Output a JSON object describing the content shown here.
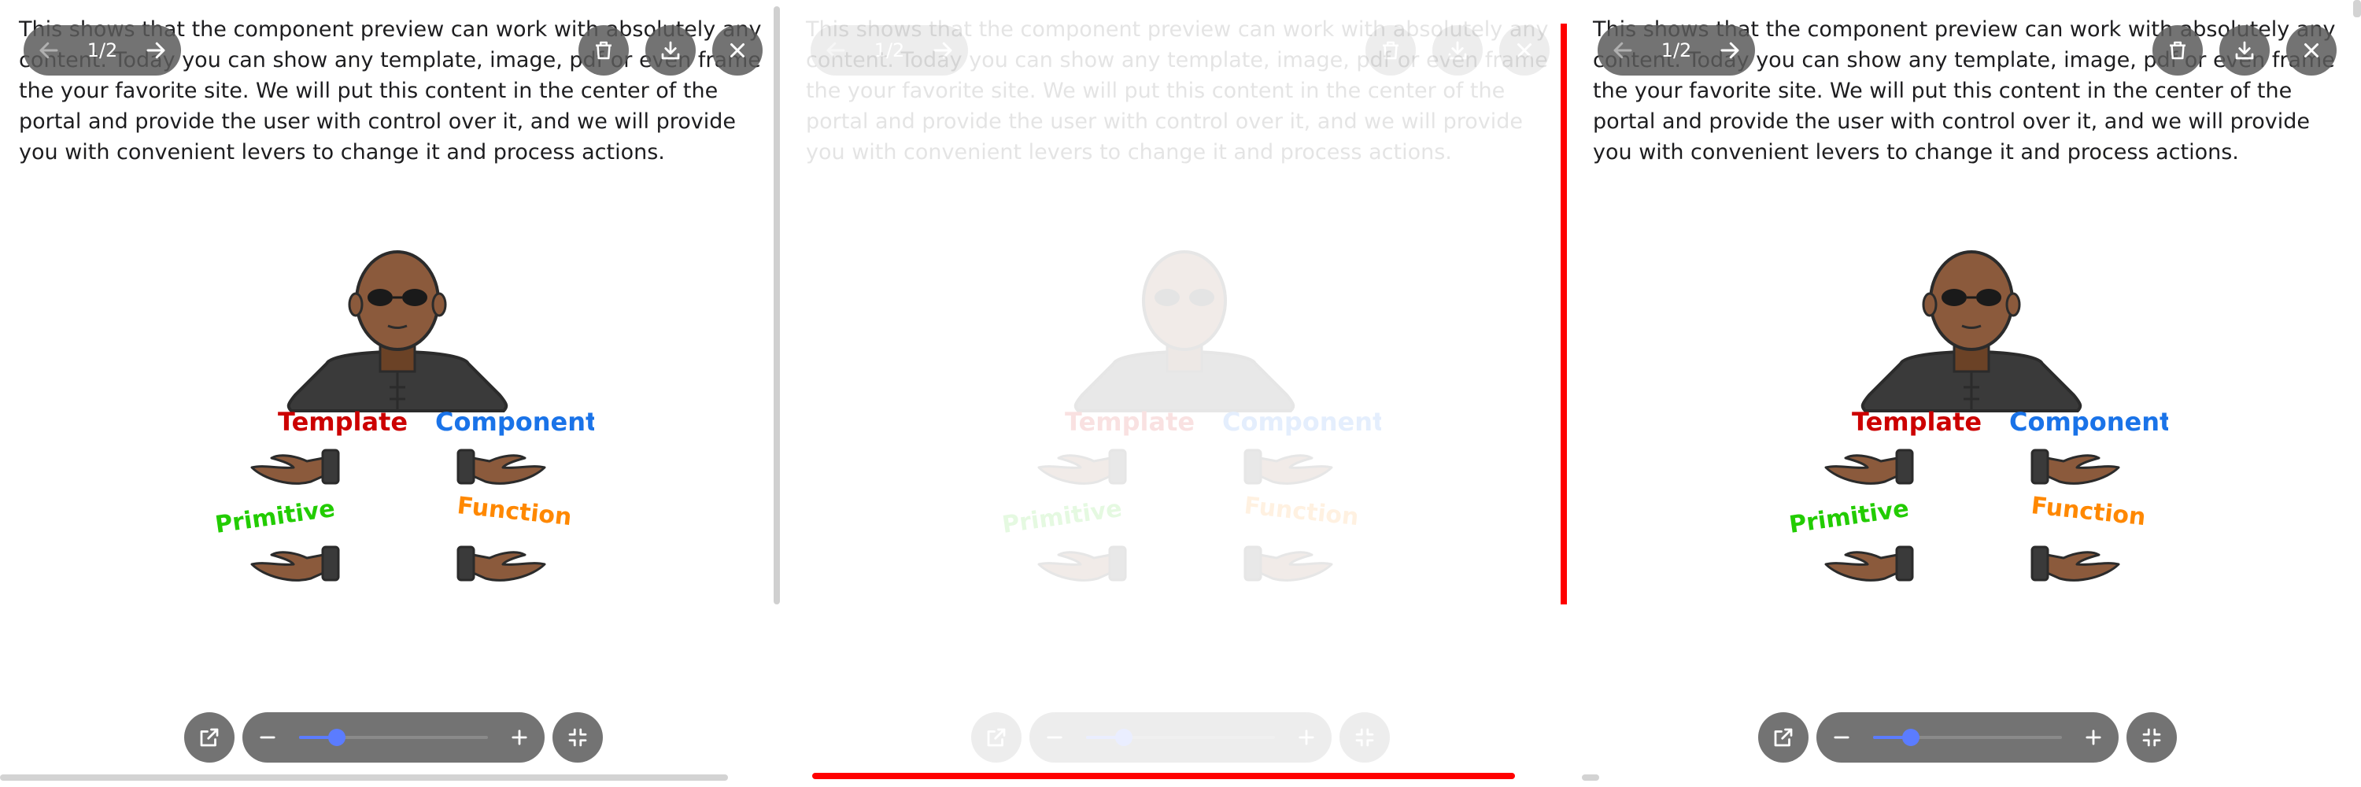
{
  "description_text": "This shows that the component preview can work with absolutely any content. Today you can show any template, image, pdf or even frame the your favorite site. We will put this content in the center of the portal and provide the user with control over it, and we will provide you with convenient levers to change it and process actions.",
  "illustration": {
    "labels": {
      "template": "Template",
      "component": "Component",
      "primitive": "Primitive",
      "function": "Function"
    },
    "colors": {
      "template": "#cc0000",
      "component": "#1a73e8",
      "primitive": "#22cc00",
      "function": "#ff8800",
      "skin": "#8b5a3c",
      "skin_shadow": "#6b4226",
      "jacket": "#3a3a3a",
      "outline": "#2b2b2b"
    }
  },
  "toolbar": {
    "page_counter": "1/2",
    "prev_icon": "arrow-left-icon",
    "next_icon": "arrow-right-icon",
    "delete_icon": "trash-icon",
    "download_icon": "download-icon",
    "close_icon": "close-icon"
  },
  "bottom_bar": {
    "share_icon": "share-icon",
    "zoom_out_icon": "minus-icon",
    "zoom_in_icon": "plus-icon",
    "fullscreen_icon": "exit-fullscreen-icon",
    "zoom_level_fraction": 0.2
  },
  "panels": [
    {
      "id": "left",
      "state": "active"
    },
    {
      "id": "middle",
      "state": "faded"
    },
    {
      "id": "right",
      "state": "active"
    }
  ],
  "accent_colors": {
    "highlight": "#ff0000",
    "slider": "#5b7cff",
    "control_bg": "#5a5a5a"
  }
}
